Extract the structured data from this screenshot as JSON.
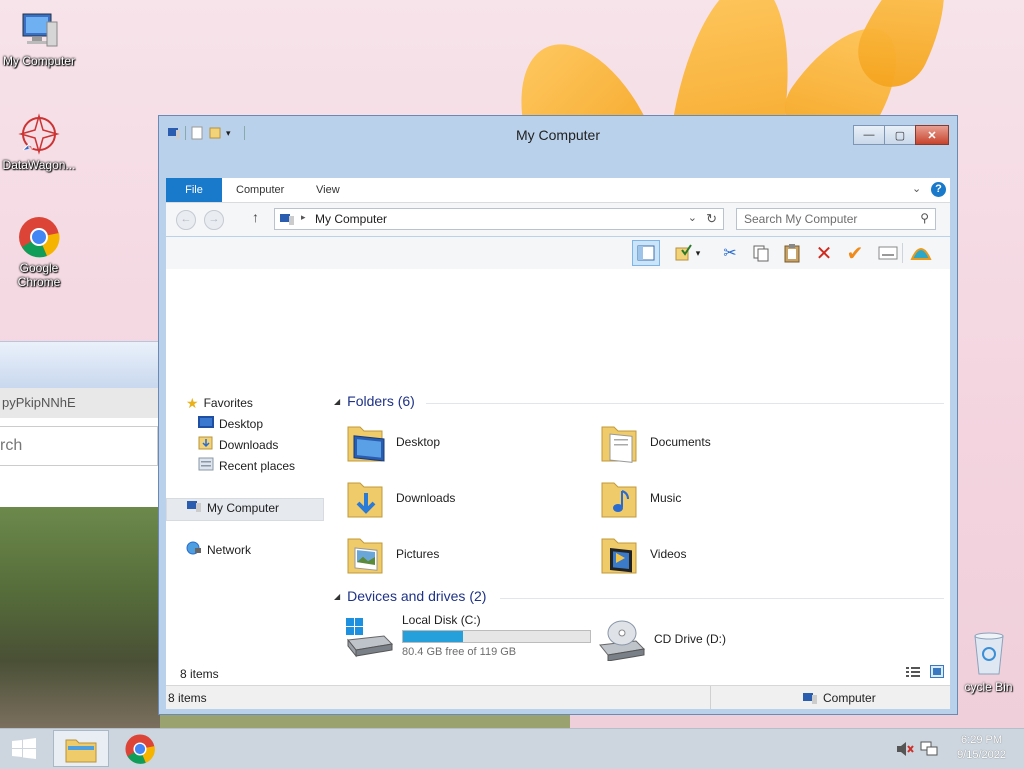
{
  "desktop": {
    "icons": [
      {
        "label": "My Computer",
        "icon": "computer-icon"
      },
      {
        "label": "DataWagon...",
        "icon": "datawagon-icon"
      },
      {
        "label": "Google Chrome",
        "icon": "chrome-icon"
      }
    ],
    "recycle_bin": {
      "label": "cycle Bin",
      "icon": "recycle-bin-icon"
    },
    "bg_window": {
      "tab_text": "pyPkipNNhE",
      "search_text": "rch"
    }
  },
  "window": {
    "title": "My Computer",
    "controls": {
      "minimize": "—",
      "maximize": "▢",
      "close": "✕"
    },
    "ribbon_tabs": [
      "File",
      "Computer",
      "View"
    ],
    "address": {
      "path": "My Computer",
      "search_placeholder": "Search My Computer"
    },
    "nav_pane": {
      "favorites": "Favorites",
      "favorite_items": [
        "Desktop",
        "Downloads",
        "Recent places"
      ],
      "my_computer": "My Computer",
      "network": "Network"
    },
    "folders_header": "Folders (6)",
    "folders": [
      {
        "name": "Desktop",
        "icon": "desktop-folder-icon"
      },
      {
        "name": "Documents",
        "icon": "documents-folder-icon"
      },
      {
        "name": "Downloads",
        "icon": "downloads-folder-icon"
      },
      {
        "name": "Music",
        "icon": "music-folder-icon"
      },
      {
        "name": "Pictures",
        "icon": "pictures-folder-icon"
      },
      {
        "name": "Videos",
        "icon": "videos-folder-icon"
      }
    ],
    "drives_header": "Devices and drives (2)",
    "drives": [
      {
        "name": "Local Disk (C:)",
        "free_text": "80.4 GB free of 119 GB",
        "used_fraction": 0.32,
        "icon": "hard-drive-icon"
      },
      {
        "name": "CD Drive (D:)",
        "icon": "cd-drive-icon"
      }
    ],
    "item_count": "8 items",
    "status_left": "8 items",
    "status_right": "Computer"
  },
  "taskbar": {
    "time": "6:29 PM",
    "date": "9/15/2022"
  },
  "colors": {
    "accent": "#1979ca",
    "progress": "#26a0da",
    "close": "#c7432c"
  }
}
